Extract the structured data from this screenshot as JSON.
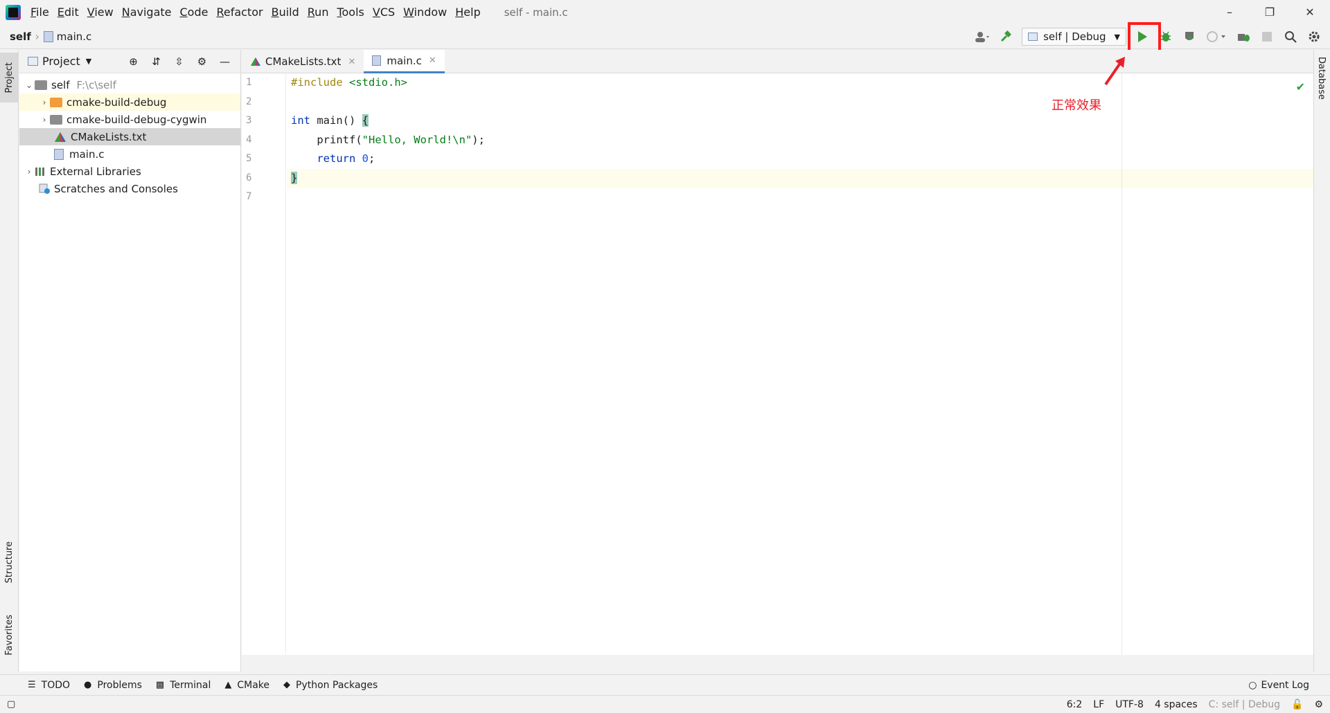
{
  "window": {
    "title": "self - main.c"
  },
  "menu": [
    {
      "label": "File",
      "u": "F",
      "rest": "ile"
    },
    {
      "label": "Edit",
      "u": "E",
      "rest": "dit"
    },
    {
      "label": "View",
      "u": "V",
      "rest": "iew"
    },
    {
      "label": "Navigate",
      "u": "N",
      "rest": "avigate"
    },
    {
      "label": "Code",
      "u": "C",
      "rest": "ode"
    },
    {
      "label": "Refactor",
      "u": "R",
      "rest": "efactor"
    },
    {
      "label": "Build",
      "u": "B",
      "rest": "uild"
    },
    {
      "label": "Run",
      "u": "R",
      "rest": "un"
    },
    {
      "label": "Tools",
      "u": "T",
      "rest": "ools"
    },
    {
      "label": "VCS",
      "u": "V",
      "rest": "CS"
    },
    {
      "label": "Window",
      "u": "W",
      "rest": "indow"
    },
    {
      "label": "Help",
      "u": "H",
      "rest": "elp"
    }
  ],
  "breadcrumb": {
    "project": "self",
    "file": "main.c"
  },
  "run_config": {
    "label": "self | Debug"
  },
  "left_tabs": {
    "project": "Project",
    "structure": "Structure",
    "favorites": "Favorites"
  },
  "right_tabs": {
    "database": "Database"
  },
  "project_panel": {
    "title": "Project",
    "tree": {
      "root": {
        "label": "self",
        "path": "F:\\c\\self"
      },
      "items": [
        {
          "label": "cmake-build-debug"
        },
        {
          "label": "cmake-build-debug-cygwin"
        },
        {
          "label": "CMakeLists.txt"
        },
        {
          "label": "main.c"
        }
      ],
      "external": "External Libraries",
      "scratches": "Scratches and Consoles"
    }
  },
  "editor": {
    "tabs": [
      {
        "label": "CMakeLists.txt"
      },
      {
        "label": "main.c"
      }
    ],
    "line_numbers": [
      "1",
      "2",
      "3",
      "4",
      "5",
      "6",
      "7"
    ],
    "code": {
      "l1_pp": "#include ",
      "l1_hdr": "<stdio.h>",
      "l3_kw": "int",
      "l3_rest": " main() ",
      "l3_brace": "{",
      "l4_fn": "    printf(",
      "l4_str": "\"Hello, World!\\n\"",
      "l4_end": ");",
      "l5_kw": "    return",
      "l5_sp": " ",
      "l5_num": "0",
      "l5_end": ";",
      "l6_brace": "}"
    }
  },
  "annotation": {
    "text": "正常效果",
    "color": "#e8202a"
  },
  "bottom_tools": {
    "todo": "TODO",
    "problems": "Problems",
    "terminal": "Terminal",
    "cmake": "CMake",
    "python_packages": "Python Packages",
    "event_log": "Event Log"
  },
  "status": {
    "position": "6:2",
    "line_sep": "LF",
    "encoding": "UTF-8",
    "indent": "4 spaces",
    "context": "C: self | Debug"
  },
  "colors": {
    "accent": "#4083c9",
    "run_green": "#3c9a3e",
    "highlight_red": "#ff1d1d"
  }
}
